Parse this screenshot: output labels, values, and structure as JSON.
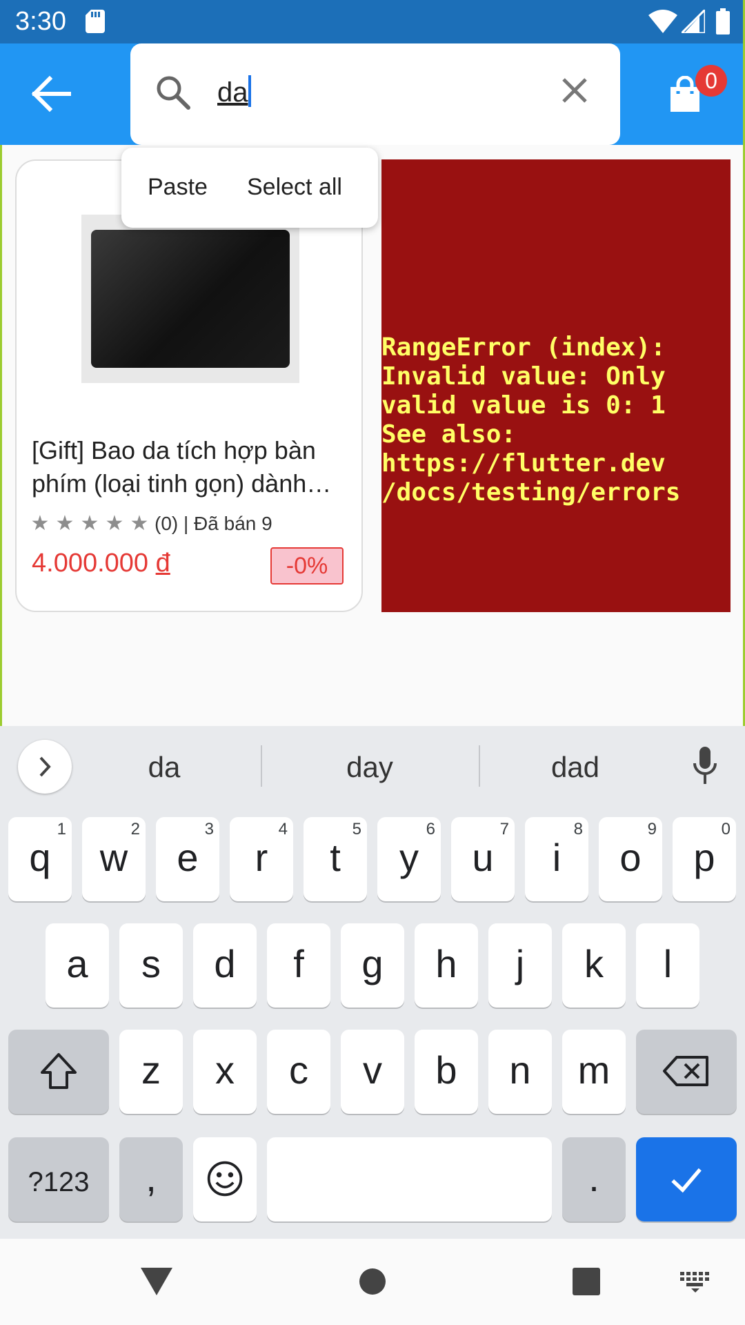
{
  "status_bar": {
    "time": "3:30"
  },
  "app_bar": {
    "search_value": "da",
    "cart_count": "0"
  },
  "context_menu": {
    "paste": "Paste",
    "select_all": "Select all"
  },
  "product": {
    "title_line1": "[Gift] Bao da tích hợp bàn",
    "title_line2": "phím (loại tinh gọn) dành…",
    "rating_text": "(0) | Đã bán 9",
    "price_value": "4.000.000",
    "price_currency": "đ",
    "discount": "-0%"
  },
  "error": {
    "message": "RangeError (index):\nInvalid value: Only\nvalid value is 0: 1\nSee also:\nhttps://flutter.dev\n/docs/testing/errors"
  },
  "keyboard": {
    "suggestions": [
      "da",
      "day",
      "dad"
    ],
    "row1": [
      {
        "k": "q",
        "h": "1"
      },
      {
        "k": "w",
        "h": "2"
      },
      {
        "k": "e",
        "h": "3"
      },
      {
        "k": "r",
        "h": "4"
      },
      {
        "k": "t",
        "h": "5"
      },
      {
        "k": "y",
        "h": "6"
      },
      {
        "k": "u",
        "h": "7"
      },
      {
        "k": "i",
        "h": "8"
      },
      {
        "k": "o",
        "h": "9"
      },
      {
        "k": "p",
        "h": "0"
      }
    ],
    "row2": [
      "a",
      "s",
      "d",
      "f",
      "g",
      "h",
      "j",
      "k",
      "l"
    ],
    "row3": [
      "z",
      "x",
      "c",
      "v",
      "b",
      "n",
      "m"
    ],
    "symbols_label": "?123",
    "comma_label": ",",
    "period_label": "."
  },
  "colors": {
    "status_bar": "#1c6fb8",
    "app_bar": "#2196f3",
    "price": "#e53935",
    "error_bg": "#991111",
    "error_text": "#ffff66",
    "enter_key": "#1a73e8"
  },
  "icons": {
    "back": "arrow-left-icon",
    "search": "magnifier-icon",
    "clear": "close-icon",
    "cart": "shopping-bag-icon",
    "star": "star-icon",
    "mic": "microphone-icon",
    "shift": "shift-arrow-icon",
    "backspace": "backspace-icon",
    "emoji": "smiley-icon",
    "enter": "checkmark-icon"
  }
}
